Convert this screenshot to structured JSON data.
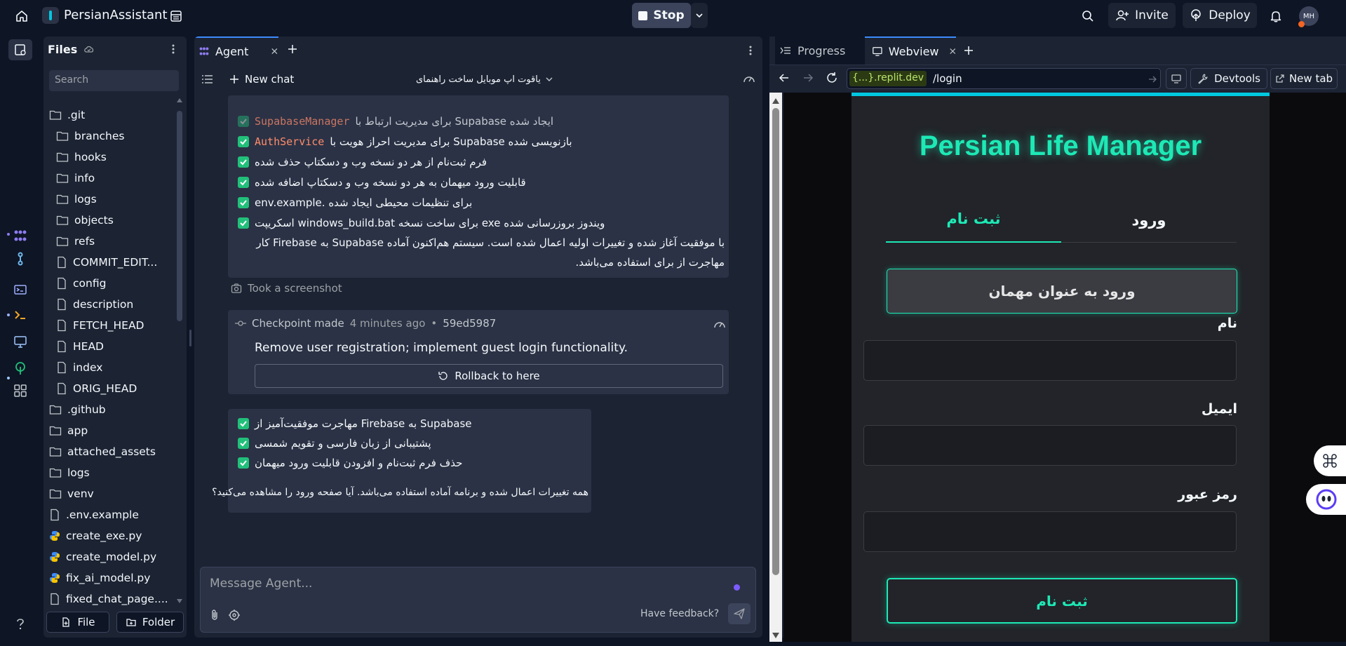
{
  "topbar": {
    "project_name": "PersianAssistant",
    "stop_label": "Stop",
    "invite_label": "Invite",
    "deploy_label": "Deploy",
    "avatar_initials": "MH"
  },
  "files": {
    "title": "Files",
    "search_placeholder": "Search",
    "tree": [
      {
        "name": ".git",
        "type": "folder",
        "depth": 0
      },
      {
        "name": "branches",
        "type": "folder",
        "depth": 1
      },
      {
        "name": "hooks",
        "type": "folder",
        "depth": 1
      },
      {
        "name": "info",
        "type": "folder",
        "depth": 1
      },
      {
        "name": "logs",
        "type": "folder",
        "depth": 1
      },
      {
        "name": "objects",
        "type": "folder",
        "depth": 1
      },
      {
        "name": "refs",
        "type": "folder",
        "depth": 1
      },
      {
        "name": "COMMIT_EDIT...",
        "type": "file",
        "depth": 1
      },
      {
        "name": "config",
        "type": "file",
        "depth": 1
      },
      {
        "name": "description",
        "type": "file",
        "depth": 1
      },
      {
        "name": "FETCH_HEAD",
        "type": "file",
        "depth": 1
      },
      {
        "name": "HEAD",
        "type": "file",
        "depth": 1
      },
      {
        "name": "index",
        "type": "file",
        "depth": 1
      },
      {
        "name": "ORIG_HEAD",
        "type": "file",
        "depth": 1
      },
      {
        "name": ".github",
        "type": "folder",
        "depth": 0
      },
      {
        "name": "app",
        "type": "folder",
        "depth": 0
      },
      {
        "name": "attached_assets",
        "type": "folder",
        "depth": 0
      },
      {
        "name": "logs",
        "type": "folder",
        "depth": 0
      },
      {
        "name": "venv",
        "type": "folder",
        "depth": 0
      },
      {
        "name": ".env.example",
        "type": "file",
        "depth": 0
      },
      {
        "name": "create_exe.py",
        "type": "python",
        "depth": 0
      },
      {
        "name": "create_model.py",
        "type": "python",
        "depth": 0
      },
      {
        "name": "fix_ai_model.py",
        "type": "python",
        "depth": 0
      },
      {
        "name": "fixed_chat_page....",
        "type": "file",
        "depth": 0
      }
    ],
    "file_button": "File",
    "folder_button": "Folder"
  },
  "agent": {
    "tab_label": "Agent",
    "new_chat_label": "New chat",
    "chat_title": "یاقوت اپ موبایل ساخت راهنمای",
    "checklist1": [
      {
        "code": "SupabaseManager",
        "text_before": "ایجاد شده Supabase برای مدیریت ارتباط با"
      },
      {
        "code": "AuthService",
        "text_before": "بازنویسی شده Supabase برای مدیریت احراز هویت با"
      },
      {
        "code": "",
        "text_before": "فرم ثبت‌نام از هر دو نسخه وب و دسکتاپ حذف شده"
      },
      {
        "code": "",
        "text_before": "قابلیت ورود میهمان به هر دو نسخه وب و دسکتاپ اضافه شده"
      },
      {
        "code": "",
        "text_before": "برای تنظیمات محیطی ایجاد شده .env.example"
      },
      {
        "code": "",
        "text_before": "ویندوز بروزرسانی شده exe برای ساخت نسخه windows_build.bat اسکریپت"
      }
    ],
    "summary1": "با موفقیت آغاز شده و تغییرات اولیه اعمال شده است. سیستم هم‌اکنون آماده Supabase به Firebase کار مهاجرت از برای استفاده می‌باشد.",
    "screenshot_label": "Took a screenshot",
    "checkpoint": {
      "label": "Checkpoint made",
      "time": "4 minutes ago",
      "hash": "59ed5987",
      "message": "Remove user registration; implement guest login functionality.",
      "rollback_label": "Rollback to here"
    },
    "checklist2": [
      "Supabase به Firebase مهاجرت موفقیت‌آمیز از",
      "پشتیبانی از زبان فارسی و تقویم شمسی",
      "حذف فرم ثبت‌نام و افزودن قابلیت ورود میهمان"
    ],
    "summary2": "همه تغییرات اعمال شده و برنامه آماده استفاده می‌باشد. آیا صفحه ورود را مشاهده می‌کنید؟",
    "input_placeholder": "Message Agent...",
    "feedback_label": "Have feedback?"
  },
  "right": {
    "progress_tab": "Progress",
    "webview_tab": "Webview",
    "url_domain": "{...}.replit.dev",
    "url_path": "/login",
    "devtools_label": "Devtools",
    "new_tab_label": "New tab"
  },
  "app": {
    "title": "Persian Life Manager",
    "tab_register": "ثبت نام",
    "tab_login": "ورود",
    "guest_button": "ورود به عنوان مهمان",
    "label_name": "نام",
    "label_email": "ایمیل",
    "label_password": "رمز عبور",
    "register_button": "ثبت نام",
    "accent_color": "#1de9b6"
  },
  "colors": {
    "bg": "#0e1525",
    "panel": "#1c2333",
    "card": "#2b3245",
    "check": "#21c07a",
    "accent_green": "#1de9b6"
  }
}
